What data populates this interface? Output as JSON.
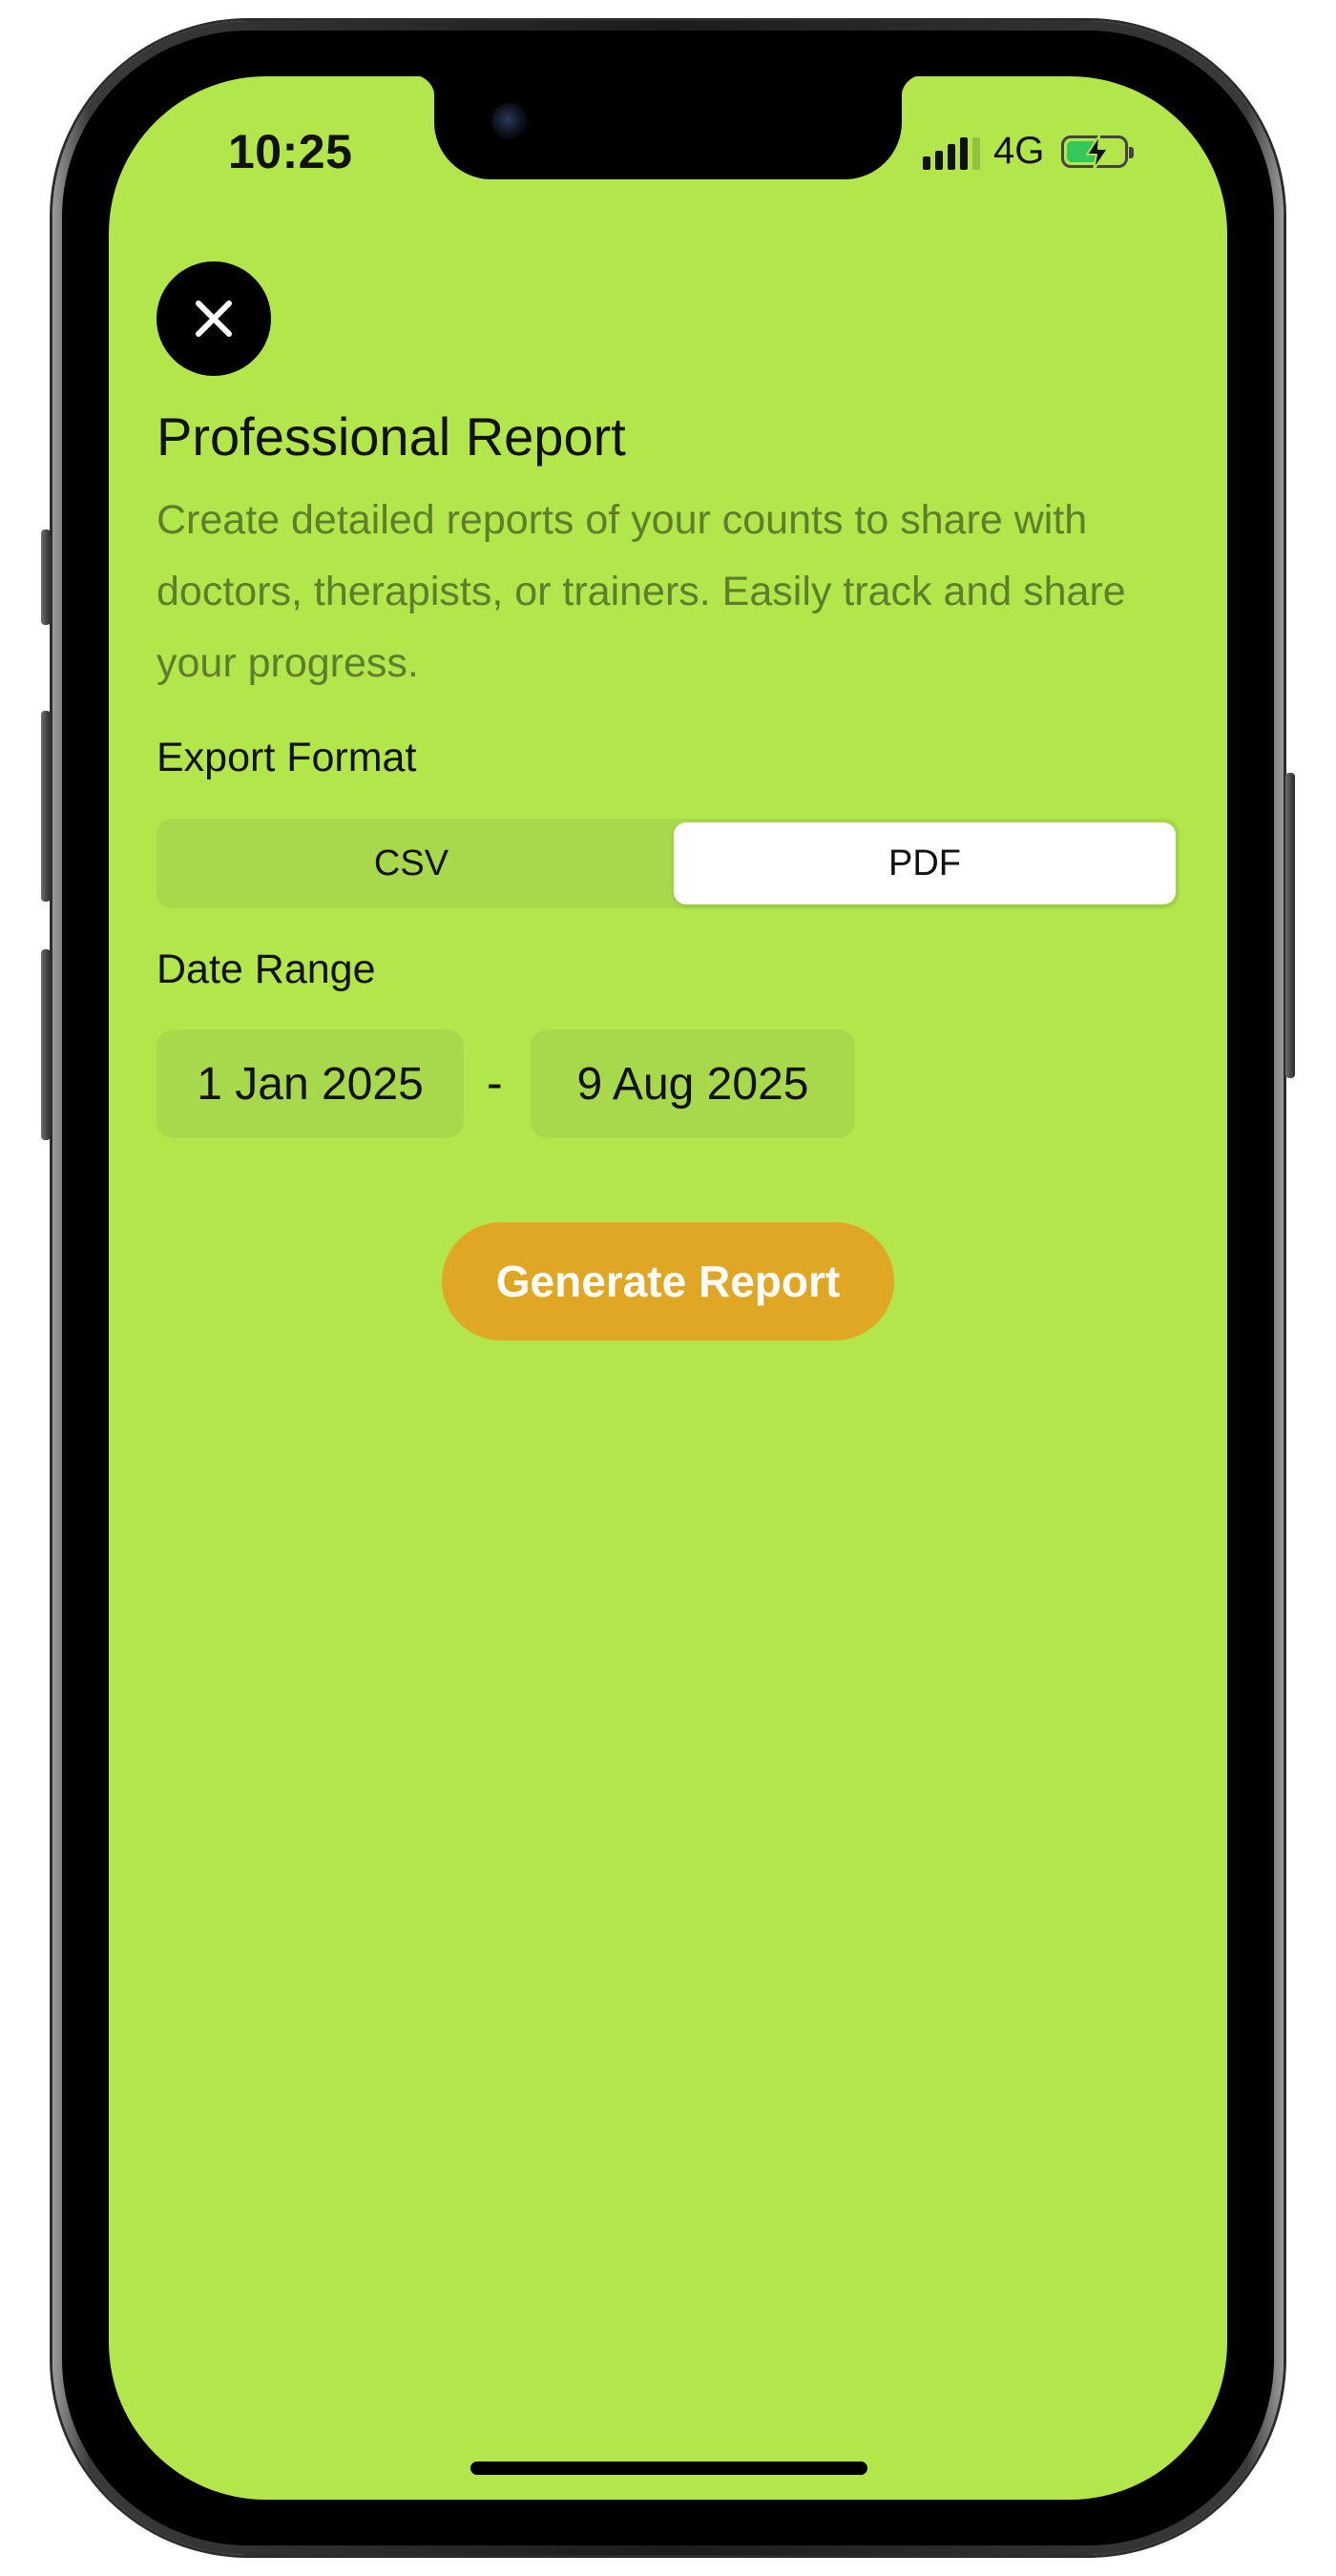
{
  "status_bar": {
    "time": "10:25",
    "network": "4G",
    "icons": [
      "signal-icon",
      "battery-charging-icon"
    ]
  },
  "header": {
    "close_icon": "close-icon",
    "title": "Professional Report",
    "description": "Create detailed reports of your counts to share with doctors, therapists, or trainers. Easily track and share your progress."
  },
  "export_format": {
    "label": "Export Format",
    "options": [
      {
        "label": "CSV",
        "selected": false
      },
      {
        "label": "PDF",
        "selected": true
      }
    ]
  },
  "date_range": {
    "label": "Date Range",
    "start": "1 Jan 2025",
    "separator": "-",
    "end": "9 Aug 2025"
  },
  "actions": {
    "generate_label": "Generate Report"
  },
  "colors": {
    "background": "#b3e64a",
    "control_fill": "#a8d94c",
    "description_text": "#5d7f2b",
    "accent_button": "#e0a724",
    "battery": "#34c759"
  }
}
